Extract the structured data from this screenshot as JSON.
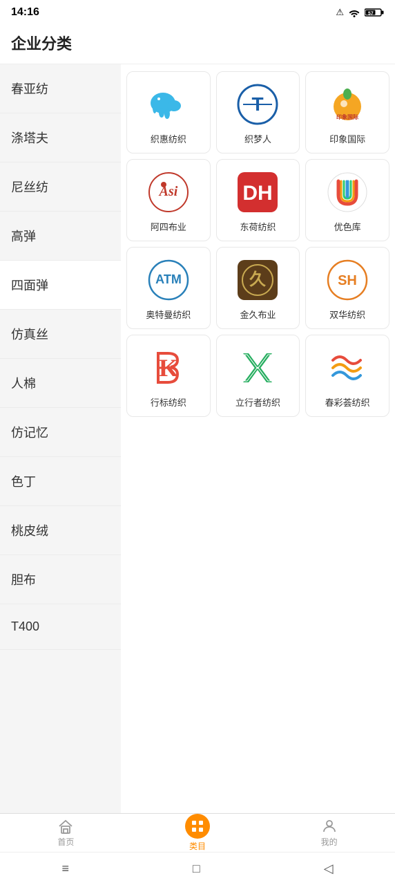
{
  "statusBar": {
    "time": "14:16",
    "warnIcon": "⚠",
    "batteryLevel": "57"
  },
  "header": {
    "title": "企业分类"
  },
  "sidebar": {
    "items": [
      {
        "id": "chunyafang",
        "label": "春亚纺",
        "active": false
      },
      {
        "id": "tutafu",
        "label": "涤塔夫",
        "active": false
      },
      {
        "id": "nisifen",
        "label": "尼丝纺",
        "active": false
      },
      {
        "id": "gaodan",
        "label": "高弹",
        "active": false
      },
      {
        "id": "simiantan",
        "label": "四面弹",
        "active": true
      },
      {
        "id": "fanzhensi",
        "label": "仿真丝",
        "active": false
      },
      {
        "id": "renman",
        "label": "人棉",
        "active": false
      },
      {
        "id": "fanjiyi",
        "label": "仿记忆",
        "active": false
      },
      {
        "id": "seding",
        "label": "色丁",
        "active": false
      },
      {
        "id": "taopirong",
        "label": "桃皮绒",
        "active": false
      },
      {
        "id": "danbu",
        "label": "胆布",
        "active": false
      },
      {
        "id": "t400",
        "label": "T400",
        "active": false
      }
    ]
  },
  "companies": [
    {
      "id": "zhihui",
      "name": "织惠纺织",
      "logoType": "elephant",
      "logoColor": "#3bb8e8",
      "bgColor": "#fff"
    },
    {
      "id": "zhimeng",
      "name": "织梦人",
      "logoType": "circle-T",
      "logoColor": "#1a5fa8",
      "bgColor": "#fff"
    },
    {
      "id": "yinxiang",
      "name": "印象国际",
      "logoType": "orange-circle",
      "logoColor": "#f5a623",
      "bgColor": "#fff"
    },
    {
      "id": "asi",
      "name": "阿四布业",
      "logoType": "asi-text",
      "logoColor": "#c0392b",
      "bgColor": "#fff"
    },
    {
      "id": "dh",
      "name": "东荷纺织",
      "logoType": "DH-text",
      "logoColor": "#e74c3c",
      "bgColor": "#d32f2f"
    },
    {
      "id": "youseku",
      "name": "优色库",
      "logoType": "U-circle",
      "logoColor": "#8e44ad",
      "bgColor": "#fff"
    },
    {
      "id": "atm",
      "name": "奥特曼纺织",
      "logoType": "ATM-circle",
      "logoColor": "#2980b9",
      "bgColor": "#fff"
    },
    {
      "id": "jinjiu",
      "name": "金久布业",
      "logoType": "JJ-gold",
      "logoColor": "#c8a951",
      "bgColor": "#7a5c1e"
    },
    {
      "id": "shuanghua",
      "name": "双华纺织",
      "logoType": "SH-circle",
      "logoColor": "#e67e22",
      "bgColor": "#fff"
    },
    {
      "id": "hangbiao",
      "name": "行标纺织",
      "logoType": "B-red",
      "logoColor": "#e74c3c",
      "bgColor": "#fff"
    },
    {
      "id": "lixingzhe",
      "name": "立行者纺织",
      "logoType": "X-green",
      "logoColor": "#27ae60",
      "bgColor": "#fff"
    },
    {
      "id": "chuncai",
      "name": "春彩荟纺织",
      "logoType": "waves",
      "logoColor": "#e67e22",
      "bgColor": "#fff"
    }
  ],
  "bottomNav": {
    "items": [
      {
        "id": "home",
        "label": "首页",
        "active": false,
        "icon": "home"
      },
      {
        "id": "category",
        "label": "类目",
        "active": true,
        "icon": "menu"
      },
      {
        "id": "profile",
        "label": "我的",
        "active": false,
        "icon": "person"
      }
    ]
  },
  "systemBar": {
    "menuIcon": "≡",
    "homeIcon": "□",
    "backIcon": "◁"
  }
}
